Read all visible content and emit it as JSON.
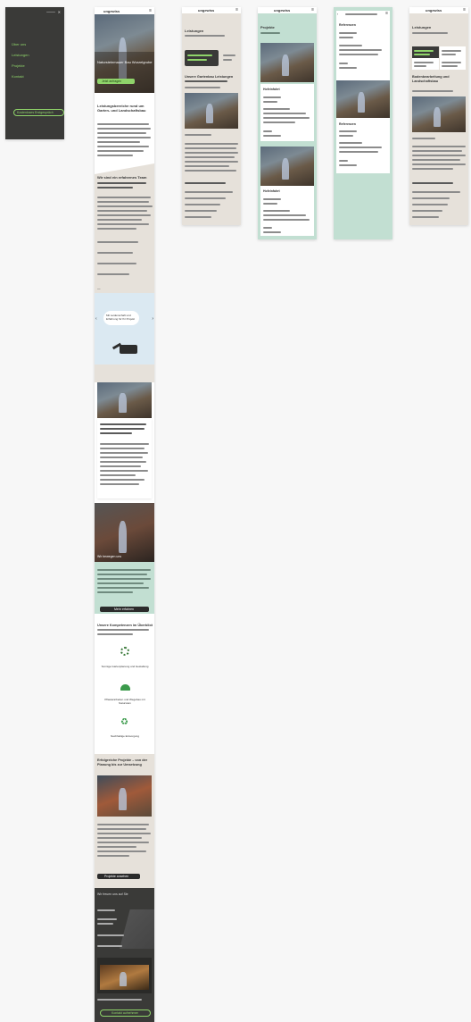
{
  "menu": {
    "close_label": "✕",
    "items": [
      "Über uns",
      "Leistungen",
      "Projekte",
      "Kontakt"
    ],
    "cta_label": "Kostenloses Erstgespräch"
  },
  "home": {
    "logo": "ungewiss",
    "hero_title": "Natursteinmauer Bau Wurzelgrube",
    "hero_cta": "Jetzt anfragen",
    "intro_title": "Leistungsbereiche rund um Garten- und Landschaftsbau",
    "services_title": "Wir sind ein erfahrenes Team",
    "quote_bubble": "Mit Leidenschaft und Erfahrung für Ihr Projekt",
    "team_caption": "Wir bewegen uns",
    "dark_cta": "Mehr erfahren",
    "features_title": "Unsere Kompetenzen im Überblick",
    "features": [
      {
        "icon": "sun-icon",
        "label": "Sonnige Gartenplanung und Gestaltung"
      },
      {
        "icon": "dome-icon",
        "label": "Pflasterarbeiten und Wegebau mit Naturstein"
      },
      {
        "icon": "recycle-icon",
        "label": "Nachhaltige Entsorgung"
      }
    ],
    "project_title": "Erfolgreiche Projekte – von der Planung bis zur Umsetzung",
    "project_cta": "Projekte ansehen",
    "footer_title": "Wir freuen uns auf Sie",
    "footer_cta": "Kontakt aufnehmen"
  },
  "screens": {
    "leistungen": {
      "title": "Leistungen",
      "section": "Unsere Gartenbau Leistungen"
    },
    "projekte": {
      "title": "Projekte",
      "card_title": "Hofeinfahrt"
    },
    "referenzen": {
      "title": "Referenzen"
    },
    "detail": {
      "title": "Leistungen",
      "heading": "Bodenbearbeitung und Landschaftsbau"
    }
  },
  "colors": {
    "accent": "#8fd46a",
    "mint": "#c2dfd2",
    "sand": "#e6e1da",
    "dark": "#3c3c3c"
  }
}
